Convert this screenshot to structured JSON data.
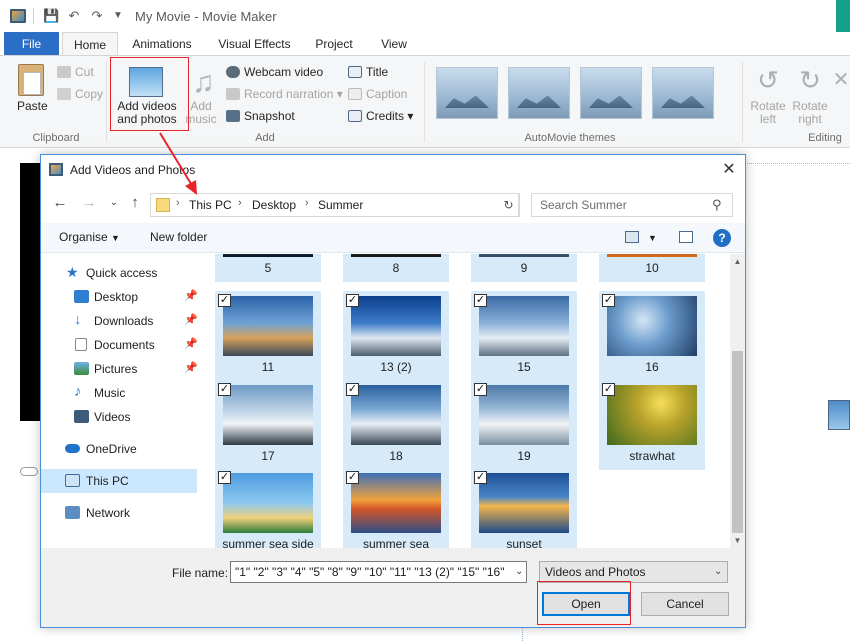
{
  "window": {
    "title": "My Movie - Movie Maker"
  },
  "tabs": [
    {
      "label": "File"
    },
    {
      "label": "Home"
    },
    {
      "label": "Animations"
    },
    {
      "label": "Visual Effects"
    },
    {
      "label": "Project"
    },
    {
      "label": "View"
    }
  ],
  "ribbon": {
    "clipboard": {
      "paste": "Paste",
      "cut": "Cut",
      "copy": "Copy",
      "label": "Clipboard"
    },
    "add": {
      "add_videos_line1": "Add videos",
      "add_videos_line2": "and photos",
      "add_music_line1": "Add",
      "add_music_line2": "music",
      "webcam": "Webcam video",
      "narration": "Record narration",
      "snapshot": "Snapshot",
      "title": "Title",
      "caption": "Caption",
      "credits": "Credits",
      "label": "Add"
    },
    "themes": {
      "label": "AutoMovie themes"
    },
    "editing": {
      "rotate_left_line1": "Rotate",
      "rotate_left_line2": "left",
      "rotate_right_line1": "Rotate",
      "rotate_right_line2": "right",
      "label": "Editing"
    }
  },
  "dialog": {
    "title": "Add Videos and Photos",
    "address": [
      "This PC",
      "Desktop",
      "Summer"
    ],
    "search_placeholder": "Search Summer",
    "toolbar": {
      "organise": "Organise",
      "new_folder": "New folder"
    },
    "nav": [
      {
        "label": "Quick access"
      },
      {
        "label": "Desktop"
      },
      {
        "label": "Downloads"
      },
      {
        "label": "Documents"
      },
      {
        "label": "Pictures"
      },
      {
        "label": "Music"
      },
      {
        "label": "Videos"
      },
      {
        "label": "OneDrive"
      },
      {
        "label": "This PC"
      },
      {
        "label": "Network"
      }
    ],
    "files": [
      {
        "name": "5"
      },
      {
        "name": "8"
      },
      {
        "name": "9"
      },
      {
        "name": "10"
      },
      {
        "name": "11"
      },
      {
        "name": "13 (2)"
      },
      {
        "name": "15"
      },
      {
        "name": "16"
      },
      {
        "name": "17"
      },
      {
        "name": "18"
      },
      {
        "name": "19"
      },
      {
        "name": "strawhat"
      },
      {
        "name": "summer sea side"
      },
      {
        "name": "summer sea"
      },
      {
        "name": "sunset"
      }
    ],
    "file_name_label": "File name:",
    "file_name_value": "\"1\" \"2\" \"3\" \"4\" \"5\" \"8\" \"9\" \"10\" \"11\" \"13 (2)\" \"15\" \"16\"",
    "file_type": "Videos and Photos",
    "open": "Open",
    "cancel": "Cancel"
  },
  "colors": {
    "accent": "#2b6ec6",
    "selection": "#cce8ff",
    "tile": "#d6eaf9",
    "highlight": "#e8242b"
  }
}
